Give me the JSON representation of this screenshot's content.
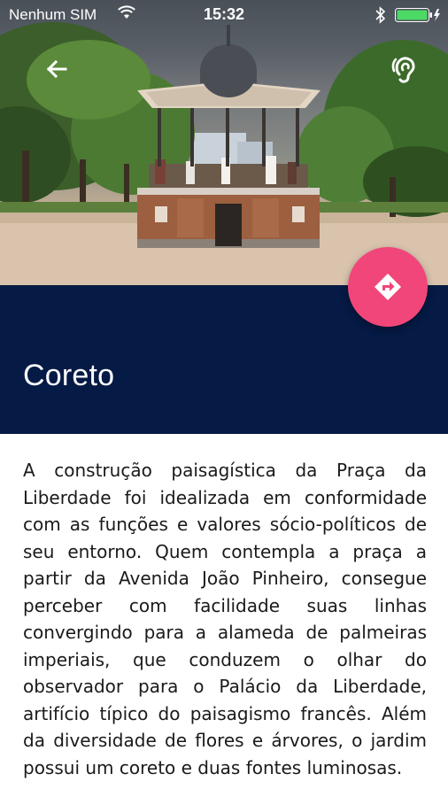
{
  "status_bar": {
    "carrier": "Nenhum SIM",
    "time": "15:32",
    "battery_color": "#4cd964"
  },
  "header": {
    "back_icon": "arrow-left-icon",
    "audio_icon": "hearing-icon"
  },
  "hero_image": {
    "subject": "bandstand-photo"
  },
  "place": {
    "title": "Coreto",
    "description": "A construção paisagística da Praça da Liberdade foi idealizada em conformidade com as funções e valores sócio-políticos de seu entorno. Quem contempla a praça a partir da Avenida João Pinheiro, consegue perceber com facilidade suas linhas convergindo para a alameda de palmeiras imperiais, que conduzem o olhar do observador para o Palácio da Liberdade, artifício típico do paisagismo francês. Além da diversidade de flores e árvores, o jardim possui um coreto e duas fontes luminosas."
  },
  "fab": {
    "icon": "directions-icon",
    "color": "#f1467a"
  },
  "colors": {
    "title_band": "#051a44",
    "text": "#1a1a1a"
  }
}
